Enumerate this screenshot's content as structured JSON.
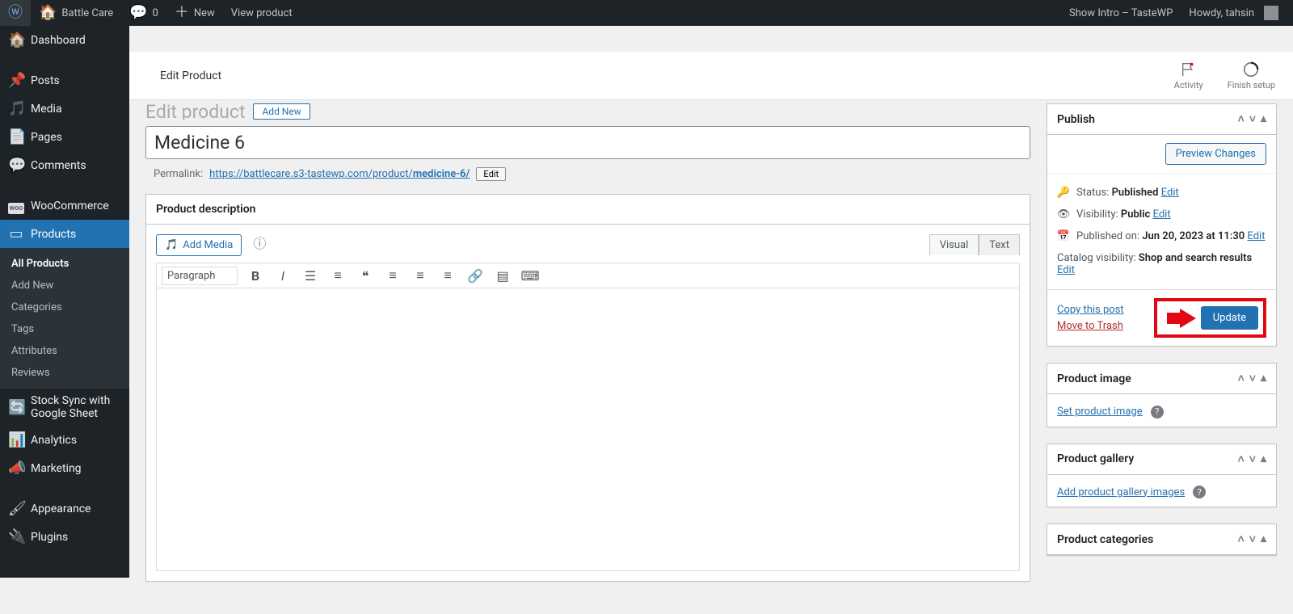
{
  "adminbar": {
    "site_name": "Battle Care",
    "comment_count": "0",
    "new_label": "New",
    "view_product": "View product",
    "show_intro": "Show Intro – TasteWP",
    "howdy": "Howdy, tahsin"
  },
  "sidebar": {
    "dashboard": "Dashboard",
    "posts": "Posts",
    "media": "Media",
    "pages": "Pages",
    "comments": "Comments",
    "woocommerce": "WooCommerce",
    "products": "Products",
    "stock_sync": "Stock Sync with Google Sheet",
    "analytics": "Analytics",
    "marketing": "Marketing",
    "appearance": "Appearance",
    "plugins": "Plugins",
    "submenu": {
      "all_products": "All Products",
      "add_new": "Add New",
      "categories": "Categories",
      "tags": "Tags",
      "attributes": "Attributes",
      "reviews": "Reviews"
    }
  },
  "topbar": {
    "title": "Edit Product",
    "activity": "Activity",
    "finish_setup": "Finish setup"
  },
  "page": {
    "heading": "Edit product",
    "add_new_btn": "Add New",
    "title_value": "Medicine 6",
    "permalink_label": "Permalink:",
    "permalink_base": "https://battlecare.s3-tastewp.com/product/",
    "permalink_slug": "medicine-6/",
    "permalink_edit": "Edit"
  },
  "editor": {
    "box_title": "Product description",
    "add_media": "Add Media",
    "visual_tab": "Visual",
    "text_tab": "Text",
    "paragraph": "Paragraph"
  },
  "publish": {
    "box_title": "Publish",
    "preview": "Preview Changes",
    "status_label": "Status:",
    "status_value": "Published",
    "visibility_label": "Visibility:",
    "visibility_value": "Public",
    "published_label": "Published on:",
    "published_value": "Jun 20, 2023 at 11:30",
    "catalog_label": "Catalog visibility:",
    "catalog_value": "Shop and search results",
    "edit": "Edit",
    "copy": "Copy this post",
    "trash": "Move to Trash",
    "update": "Update"
  },
  "product_image": {
    "box_title": "Product image",
    "link": "Set product image"
  },
  "gallery": {
    "box_title": "Product gallery",
    "link": "Add product gallery images"
  },
  "categories": {
    "box_title": "Product categories"
  }
}
